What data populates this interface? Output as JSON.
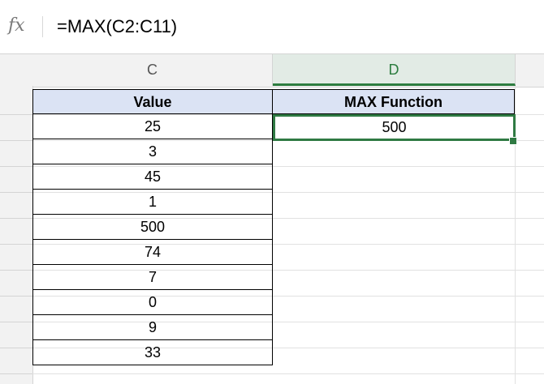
{
  "formula_bar": {
    "fx_label": "fx",
    "formula": "=MAX(C2:C11)"
  },
  "columns": {
    "c_label": "C",
    "d_label": "D"
  },
  "table": {
    "value_header": "Value",
    "max_header": "MAX Function",
    "values": [
      "25",
      "3",
      "45",
      "1",
      "500",
      "74",
      "7",
      "0",
      "9",
      "33"
    ],
    "max_result": "500"
  },
  "colors": {
    "selection": "#2f7a43",
    "header_fill": "#dbe3f4"
  }
}
